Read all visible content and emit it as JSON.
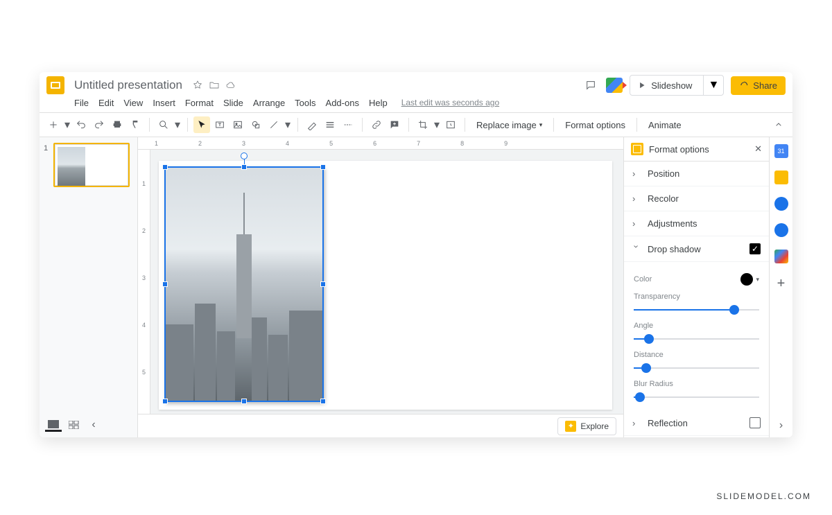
{
  "header": {
    "doc_title": "Untitled presentation",
    "slideshow_label": "Slideshow",
    "share_label": "Share",
    "last_edit": "Last edit was seconds ago"
  },
  "menus": [
    "File",
    "Edit",
    "View",
    "Insert",
    "Format",
    "Slide",
    "Arrange",
    "Tools",
    "Add-ons",
    "Help"
  ],
  "toolbar": {
    "replace_image": "Replace image",
    "format_options": "Format options",
    "animate": "Animate"
  },
  "ruler_h": [
    "1",
    "2",
    "3",
    "4",
    "5",
    "6",
    "7",
    "8",
    "9"
  ],
  "ruler_v": [
    "1",
    "2",
    "3",
    "4",
    "5"
  ],
  "slides": [
    {
      "number": "1"
    }
  ],
  "explore": "Explore",
  "format_panel": {
    "title": "Format options",
    "sections": {
      "position": "Position",
      "recolor": "Recolor",
      "adjustments": "Adjustments",
      "drop_shadow": "Drop shadow",
      "reflection": "Reflection"
    },
    "drop_shadow": {
      "checked": true,
      "color_label": "Color",
      "color_value": "#000000",
      "transparency": {
        "label": "Transparency",
        "value": 80
      },
      "angle": {
        "label": "Angle",
        "value": 12
      },
      "distance": {
        "label": "Distance",
        "value": 10
      },
      "blur": {
        "label": "Blur Radius",
        "value": 5
      }
    },
    "reflection_checked": false
  },
  "watermark": "SLIDEMODEL.COM"
}
